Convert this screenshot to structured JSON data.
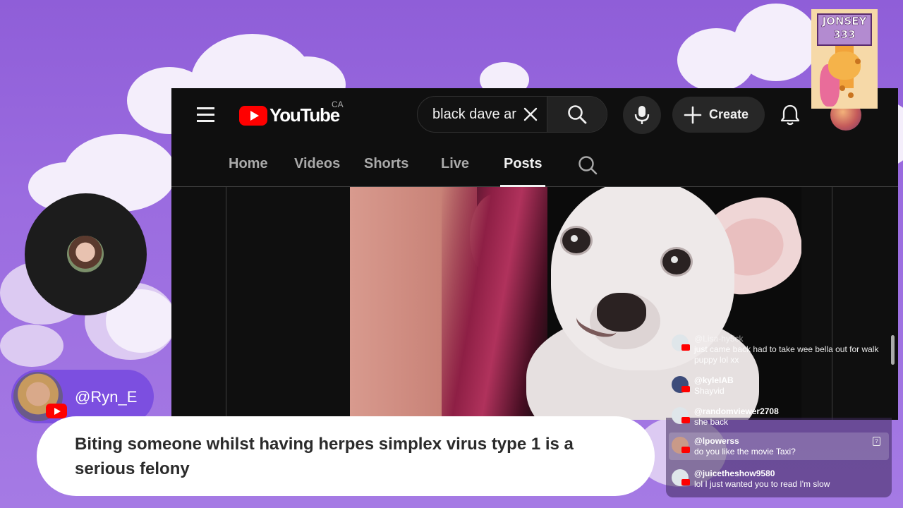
{
  "youtube": {
    "logo_text": "YouTube",
    "region": "CA",
    "search": {
      "query": "black dave ar"
    },
    "create_label": "Create",
    "icons": [
      "menu-icon",
      "clear-icon",
      "search-icon",
      "mic-icon",
      "plus-icon",
      "bell-icon",
      "channel-search-icon"
    ],
    "tabs": [
      {
        "label": "Home",
        "active": false
      },
      {
        "label": "Videos",
        "active": false
      },
      {
        "label": "Shorts",
        "active": false
      },
      {
        "label": "Live",
        "active": false
      },
      {
        "label": "Posts",
        "active": true
      }
    ]
  },
  "overlay": {
    "logo_lines": [
      "JONSEY",
      "333"
    ],
    "name_tag": {
      "username": "@Ryn_E"
    },
    "message": "Biting someone whilst having herpes simplex virus type 1 is a serious felony"
  },
  "chat": {
    "messages": [
      {
        "user": "@Lisa-hy5ck",
        "text": "just came back had to take wee bella out for walk puppy lol xx",
        "faded": true
      },
      {
        "user": "@kyleIAB",
        "text": "Shayvid"
      },
      {
        "user": "@randomviewer2708",
        "text": "she back"
      },
      {
        "user": "@lpowerss",
        "text": "do you like the movie Taxi?",
        "highlighted": true
      },
      {
        "user": "@juicetheshow9580",
        "text": "lol I just wanted you to read I'm slow"
      }
    ]
  },
  "colors": {
    "background": "#9b6ce0",
    "youtube_red": "#ff0000",
    "youtube_dark": "#0f0f0f",
    "name_tag": "#7c4fe0"
  }
}
